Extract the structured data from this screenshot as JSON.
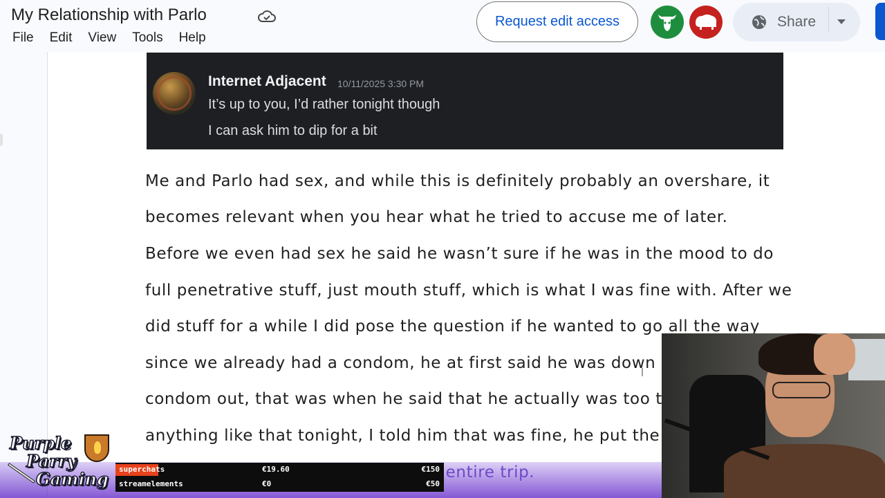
{
  "header": {
    "doc_title": "My Relationship with Parlo",
    "menu": [
      "File",
      "Edit",
      "View",
      "Tools",
      "Help"
    ],
    "request_button": "Request edit access",
    "share_label": "Share"
  },
  "discord": {
    "username": "Internet Adjacent",
    "timestamp": "10/11/2025 3:30 PM",
    "message_1": "It’s up to you, I’d rather tonight though",
    "message_2": "I can ask him to dip for a bit"
  },
  "document": {
    "lines": [
      "Me and Parlo had sex, and while this is definitely probably an overshare, it",
      "becomes relevant when you hear what he tried to accuse me of later.",
      "Before we even had sex he said he wasn’t sure if he was in the mood to do",
      "full penetrative stuff, just mouth stuff, which is what I was fine with. After we",
      "did stuff for a while I did pose the question if he wanted to go all the way",
      "since we already had a condom, he at first said he was down",
      "condom out, that was when he said that he actually was too t",
      "anything like that tonight, I told him that was fine, he put the",
      "e entire trip."
    ]
  },
  "overlay": {
    "logo_lines": [
      "Purple",
      "Parry",
      "Gaming"
    ],
    "counters": [
      {
        "label": "superchats",
        "current": "€19.60",
        "goal": "€150",
        "progress": 0.13
      },
      {
        "label": "streamelements",
        "current": "€0",
        "goal": "€50",
        "progress": 0
      }
    ]
  },
  "icons": {
    "cloud": "cloud-saved-icon",
    "globe": "globe-icon",
    "avatar_1": "bull-avatar-icon",
    "avatar_2": "bison-avatar-icon"
  },
  "colors": {
    "accent_blue": "#0b57d0",
    "avatar_green": "#1e8e3e",
    "avatar_red": "#c5221f",
    "overlay_purple": "#6b49c5",
    "counter_bar": "#e8421c"
  }
}
